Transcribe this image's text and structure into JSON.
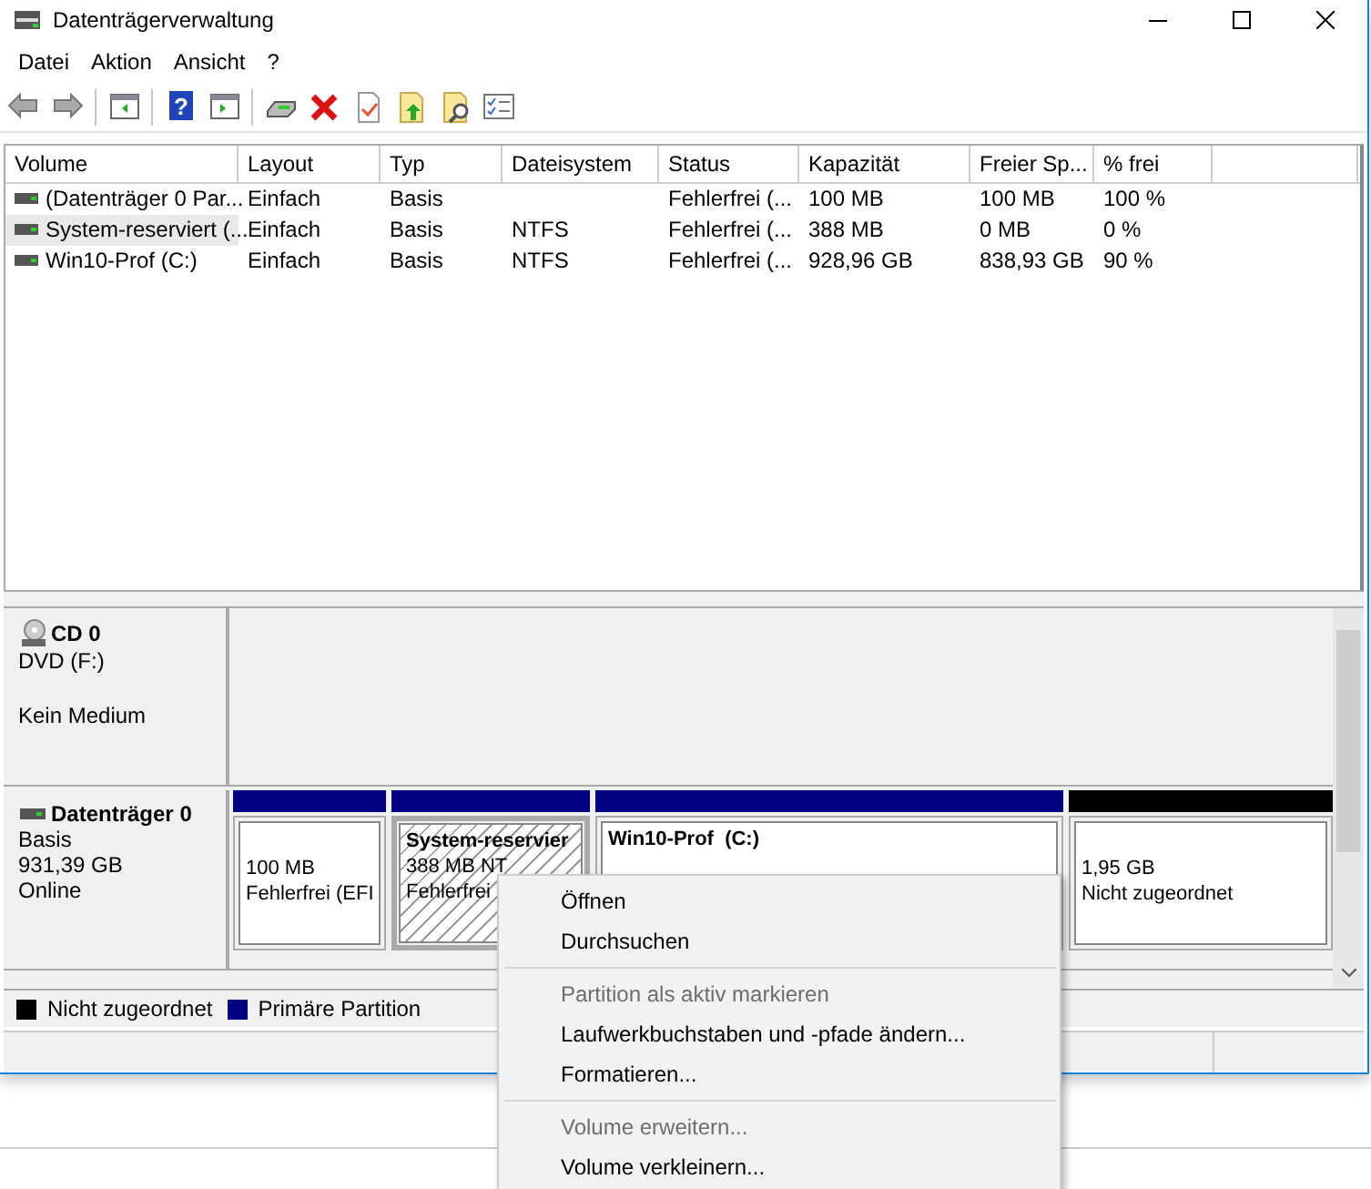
{
  "window": {
    "title": "Datenträgerverwaltung"
  },
  "menu_bar": [
    "Datei",
    "Aktion",
    "Ansicht",
    "?"
  ],
  "toolbar": {
    "help_icon_text": "?"
  },
  "table": {
    "columns": [
      "Volume",
      "Layout",
      "Typ",
      "Dateisystem",
      "Status",
      "Kapazität",
      "Freier Sp...",
      "% frei"
    ],
    "rows": [
      {
        "selected": false,
        "cells": [
          "(Datenträger 0 Par...",
          "Einfach",
          "Basis",
          "",
          "Fehlerfrei (...",
          "100 MB",
          "100 MB",
          "100 %"
        ]
      },
      {
        "selected": true,
        "cells": [
          "System-reserviert (...",
          "Einfach",
          "Basis",
          "NTFS",
          "Fehlerfrei (...",
          "388 MB",
          "0 MB",
          "0 %"
        ]
      },
      {
        "selected": false,
        "cells": [
          "Win10-Prof (C:)",
          "Einfach",
          "Basis",
          "NTFS",
          "Fehlerfrei (...",
          "928,96 GB",
          "838,93 GB",
          "90 %"
        ]
      }
    ]
  },
  "disks": [
    {
      "kind": "cd",
      "name": "CD 0",
      "type": "DVD (F:)",
      "status": "Kein Medium"
    },
    {
      "kind": "disk",
      "name": "Datenträger 0",
      "type": "Basis",
      "size": "931,39 GB",
      "status": "Online",
      "partitions": [
        {
          "color": "#000080",
          "selected": false,
          "lines": [
            "100 MB",
            "Fehlerfrei (EFI"
          ]
        },
        {
          "color": "#000080",
          "selected": true,
          "title": "System-reservier",
          "lines": [
            "388 MB NT",
            "Fehlerfrei"
          ]
        },
        {
          "color": "#000080",
          "selected": false,
          "title": "Win10-Prof  (C:)"
        },
        {
          "color": "#000000",
          "selected": false,
          "lines": [
            "1,95 GB",
            "Nicht zugeordnet"
          ]
        }
      ]
    }
  ],
  "legend": [
    {
      "label": "Nicht zugeordnet",
      "color": "#000000"
    },
    {
      "label": "Primäre Partition",
      "color": "#000080"
    }
  ],
  "context_menu": {
    "items": [
      {
        "kind": "item",
        "label": "Öffnen",
        "disabled": false
      },
      {
        "kind": "item",
        "label": "Durchsuchen",
        "disabled": false
      },
      {
        "kind": "separator"
      },
      {
        "kind": "item",
        "label": "Partition als aktiv markieren",
        "disabled": true
      },
      {
        "kind": "item",
        "label": "Laufwerkbuchstaben und -pfade ändern...",
        "disabled": false
      },
      {
        "kind": "item",
        "label": "Formatieren...",
        "disabled": false
      },
      {
        "kind": "separator"
      },
      {
        "kind": "item",
        "label": "Volume erweitern...",
        "disabled": true
      },
      {
        "kind": "item",
        "label": "Volume verkleinern...",
        "disabled": false
      }
    ]
  }
}
